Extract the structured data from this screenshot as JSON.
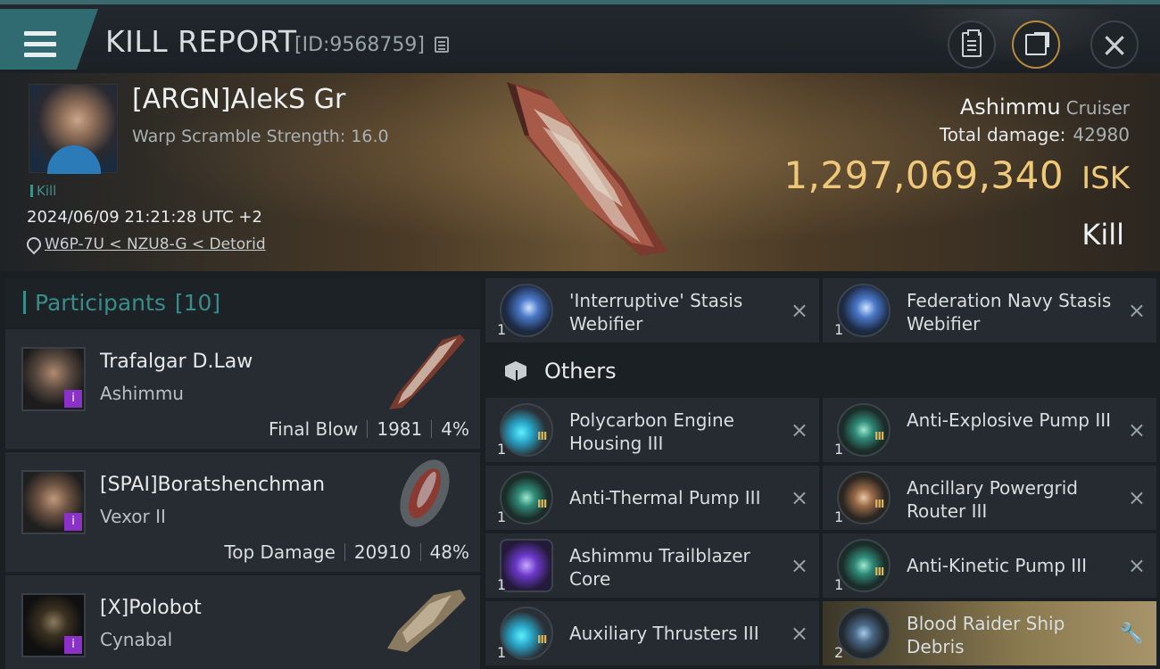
{
  "header": {
    "title": "KILL REPORT",
    "kill_id": "[ID:9568759]"
  },
  "victim": {
    "name": "[ARGN]AlekS Gr",
    "warp_scramble": "Warp Scramble Strength: 16.0",
    "tag": "Kill",
    "datetime": "2024/06/09 21:21:28 UTC +2",
    "location": "W6P-7U < NZU8-G < Detorid",
    "ship": "Ashimmu",
    "ship_class": "Cruiser",
    "total_damage_label": "Total damage:",
    "total_damage": "42980",
    "isk_value": "1,297,069,340",
    "isk_unit": "ISK",
    "result": "Kill"
  },
  "participants": {
    "label": "Participants",
    "count": "[10]",
    "rows": [
      {
        "name": "Trafalgar D.Law",
        "ship": "Ashimmu",
        "stat_label": "Final Blow",
        "damage": "1981",
        "percent": "4%"
      },
      {
        "name": "[SPAI]Boratshenchman",
        "ship": "Vexor II",
        "stat_label": "Top Damage",
        "damage": "20910",
        "percent": "48%"
      },
      {
        "name": "[X]Polobot",
        "ship": "Cynabal",
        "stat_label": "",
        "damage": "",
        "percent": ""
      }
    ]
  },
  "items": {
    "top": [
      {
        "qty": "1",
        "name": "'Interruptive' Stasis Webifier",
        "icon": "stasis-webifier-icon"
      },
      {
        "qty": "1",
        "name": "Federation Navy Stasis Webifier",
        "icon": "stasis-webifier-icon"
      }
    ],
    "others_label": "Others",
    "others": [
      {
        "qty": "1",
        "level": "III",
        "name": "Polycarbon Engine Housing III",
        "icon": "engine-housing-icon"
      },
      {
        "qty": "1",
        "level": "III",
        "name": "Anti-Explosive Pump III",
        "icon": "pump-icon"
      },
      {
        "qty": "1",
        "level": "III",
        "name": "Anti-Thermal Pump III",
        "icon": "pump-icon"
      },
      {
        "qty": "1",
        "level": "III",
        "name": "Ancillary Powergrid Router III",
        "icon": "powergrid-router-icon"
      },
      {
        "qty": "1",
        "level": "",
        "name": "Ashimmu Trailblazer Core",
        "icon": "core-icon"
      },
      {
        "qty": "1",
        "level": "III",
        "name": "Anti-Kinetic Pump III",
        "icon": "pump-icon"
      },
      {
        "qty": "1",
        "level": "III",
        "name": "Auxiliary Thrusters III",
        "icon": "thrusters-icon"
      },
      {
        "qty": "2",
        "level": "",
        "name": "Blood Raider Ship Debris",
        "icon": "debris-icon"
      }
    ]
  },
  "colors": {
    "accent": "#2f6b70",
    "isk": "#f0c87a",
    "teal_text": "#3a8c8a",
    "highlight": "#a8946a"
  }
}
